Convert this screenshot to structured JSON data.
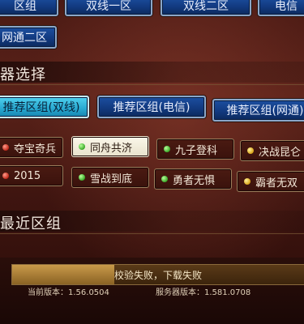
{
  "zone_tabs": {
    "items": [
      {
        "label": "区组"
      },
      {
        "label": "双线一区"
      },
      {
        "label": "双线二区"
      },
      {
        "label": "电信"
      },
      {
        "label": "网通二区"
      }
    ]
  },
  "server_select": {
    "title": "器选择",
    "recommend_tabs": [
      {
        "label": "推荐区组(双线)",
        "active": true
      },
      {
        "label": "推荐区组(电信)",
        "active": false
      },
      {
        "label": "推荐区组(网通)",
        "active": false
      }
    ],
    "servers": [
      {
        "label": "夺宝奇兵",
        "status": "red",
        "selected": false
      },
      {
        "label": "同舟共济",
        "status": "green",
        "selected": true
      },
      {
        "label": "九子登科",
        "status": "green",
        "selected": false
      },
      {
        "label": "决战昆仑",
        "status": "yellow",
        "selected": false
      },
      {
        "label": "2015",
        "status": "red",
        "selected": false
      },
      {
        "label": "雪战到底",
        "status": "green",
        "selected": false
      },
      {
        "label": "勇者无惧",
        "status": "green",
        "selected": false
      },
      {
        "label": "霸者无双",
        "status": "yellow",
        "selected": false
      }
    ]
  },
  "recent": {
    "title": "最近区组"
  },
  "download": {
    "status_text": "校验失败，下载失败",
    "progress": 0.35,
    "current_version_label": "当前版本：",
    "current_version": "1.56.0504",
    "server_version_label": "服务器版本：",
    "server_version": "1.581.0708"
  },
  "colors": {
    "accent_blue": "#1c4fa0",
    "active_tab": "#27a8d0",
    "panel_bg": "#4a1a14",
    "status_green": "#3aa828",
    "status_red": "#c0281a",
    "status_yellow": "#d8a418"
  }
}
